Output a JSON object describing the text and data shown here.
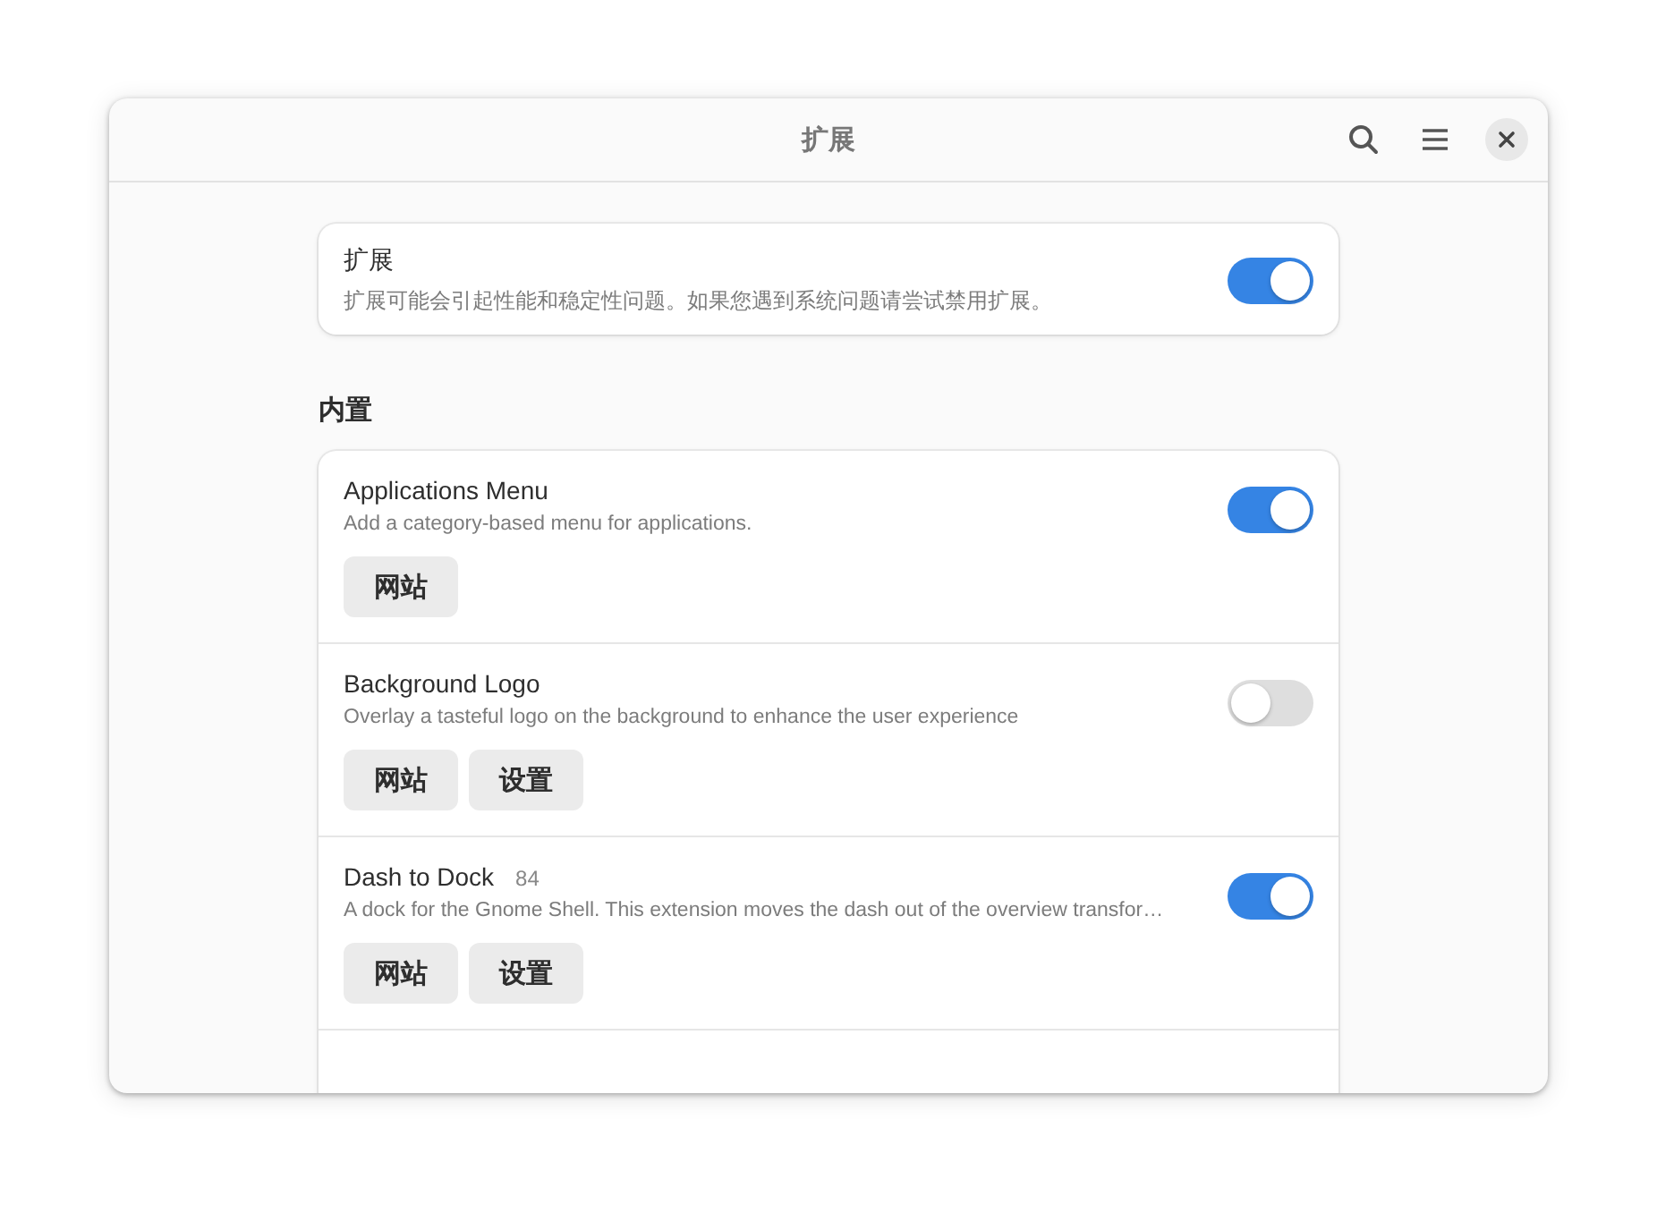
{
  "window": {
    "title": "扩展"
  },
  "master": {
    "title": "扩展",
    "description": "扩展可能会引起性能和稳定性问题。如果您遇到系统问题请尝试禁用扩展。",
    "on": true
  },
  "section": {
    "heading": "内置"
  },
  "extensions": [
    {
      "name": "Applications Menu",
      "description": "Add a category-based menu for applications.",
      "on": true,
      "buttons": [
        "网站"
      ]
    },
    {
      "name": "Background Logo",
      "description": "Overlay a tasteful logo on the background to enhance the user experience",
      "on": false,
      "buttons": [
        "网站",
        "设置"
      ]
    },
    {
      "name": "Dash to Dock",
      "version": "84",
      "description": "A dock for the Gnome Shell. This extension moves the dash out of the overview transfor…",
      "on": true,
      "buttons": [
        "网站",
        "设置"
      ]
    }
  ]
}
